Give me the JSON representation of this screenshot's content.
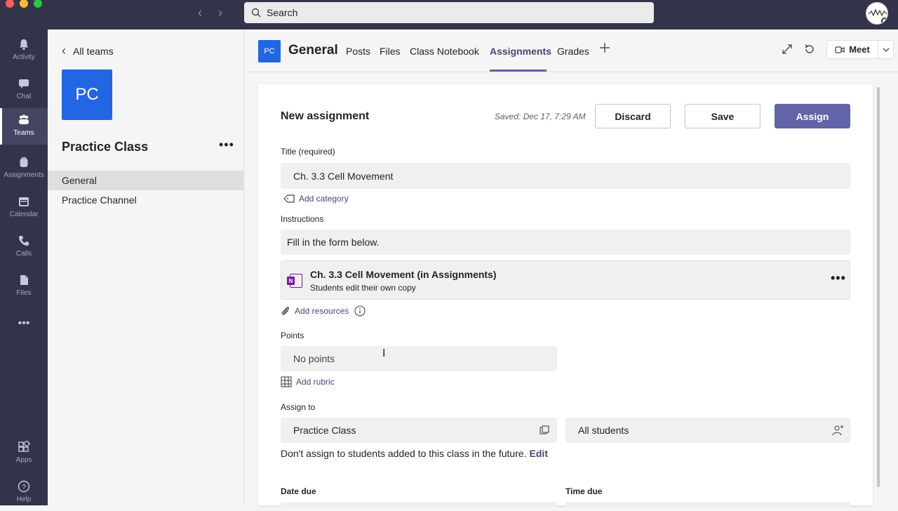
{
  "search": {
    "placeholder": "Search"
  },
  "rail": {
    "items": [
      {
        "label": "Activity"
      },
      {
        "label": "Chat"
      },
      {
        "label": "Teams"
      },
      {
        "label": "Assignments"
      },
      {
        "label": "Calendar"
      },
      {
        "label": "Calls"
      },
      {
        "label": "Files"
      },
      {
        "label": "Apps"
      },
      {
        "label": "Help"
      }
    ],
    "more": "•••"
  },
  "team": {
    "back_label": "All teams",
    "initials": "PC",
    "name": "Practice Class",
    "more": "•••",
    "channels": [
      "General",
      "Practice Channel"
    ]
  },
  "header": {
    "initials": "PC",
    "channel": "General",
    "tabs": [
      "Posts",
      "Files",
      "Class Notebook",
      "Assignments",
      "Grades"
    ],
    "active_tab": "Assignments",
    "meet_label": "Meet"
  },
  "assignment": {
    "heading": "New assignment",
    "saved": "Saved: Dec 17, 7:29 AM",
    "discard_label": "Discard",
    "save_label": "Save",
    "assign_label": "Assign",
    "title_label": "Title (required)",
    "title_value": "Ch. 3.3 Cell Movement",
    "add_category": "Add category",
    "instructions_label": "Instructions",
    "instructions_value": "Fill in the form below.",
    "resource": {
      "title": "Ch. 3.3 Cell Movement (in Assignments)",
      "subtitle": "Students edit their own copy"
    },
    "add_resources": "Add resources",
    "points_label": "Points",
    "points_value": "No points",
    "add_rubric": "Add rubric",
    "assign_to_label": "Assign to",
    "class_value": "Practice Class",
    "students_value": "All students",
    "future_note": "Don't assign to students added to this class in the future.",
    "edit_label": "Edit",
    "date_due_label": "Date due",
    "time_due_label": "Time due"
  },
  "colors": {
    "accent": "#6264a7",
    "rail": "#33344a",
    "tile": "#2266e3"
  }
}
